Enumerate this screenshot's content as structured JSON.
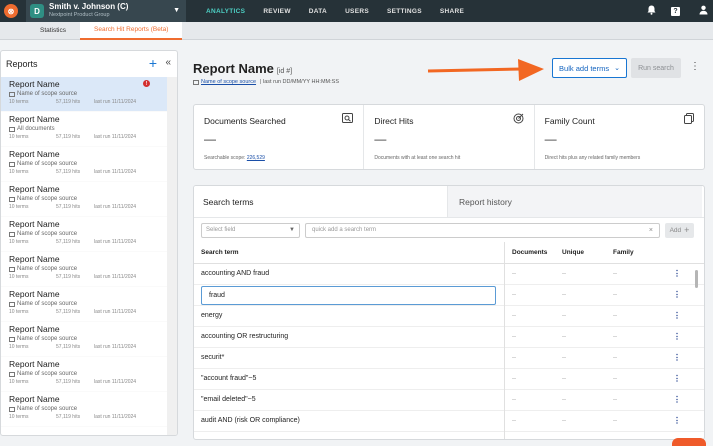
{
  "topbar": {
    "logo_letter": "⊗",
    "case_avatar": "D",
    "case_name": "Smith v. Johnson (C)",
    "case_sub": "Nextpoint Product Group",
    "nav": [
      "ANALYTICS",
      "REVIEW",
      "DATA",
      "USERS",
      "SETTINGS",
      "SHARE"
    ],
    "active_nav": "ANALYTICS",
    "help_label": "?"
  },
  "subtabs": [
    "Statistics",
    "Search Hit Reports (Beta)"
  ],
  "sidebar": {
    "title": "Reports",
    "reports": [
      {
        "name": "Report Name",
        "scope": "Name of scope source",
        "terms": "10 terms",
        "hits": "57,119 hits",
        "run": "last run 11/11/2024",
        "selected": true,
        "alert": "!"
      },
      {
        "name": "Report Name",
        "scope": "All documents",
        "terms": "10 terms",
        "hits": "57,119 hits",
        "run": "last run 11/11/2024"
      },
      {
        "name": "Report Name",
        "scope": "Name of scope source",
        "terms": "10 terms",
        "hits": "57,119 hits",
        "run": "last run 11/11/2024"
      },
      {
        "name": "Report Name",
        "scope": "Name of scope source",
        "terms": "10 terms",
        "hits": "57,119 hits",
        "run": "last run 11/11/2024"
      },
      {
        "name": "Report Name",
        "scope": "Name of scope source",
        "terms": "10 terms",
        "hits": "57,119 hits",
        "run": "last run 11/11/2024"
      },
      {
        "name": "Report Name",
        "scope": "Name of scope source",
        "terms": "10 terms",
        "hits": "57,119 hits",
        "run": "last run 11/11/2024"
      },
      {
        "name": "Report Name",
        "scope": "Name of scope source",
        "terms": "10 terms",
        "hits": "57,119 hits",
        "run": "last run 11/11/2024"
      },
      {
        "name": "Report Name",
        "scope": "Name of scope source",
        "terms": "10 terms",
        "hits": "57,119 hits",
        "run": "last run 11/11/2024"
      },
      {
        "name": "Report Name",
        "scope": "Name of scope source",
        "terms": "10 terms",
        "hits": "57,119 hits",
        "run": "last run 11/11/2024"
      },
      {
        "name": "Report Name",
        "scope": "Name of scope source",
        "terms": "10 terms",
        "hits": "57,119 hits",
        "run": "last run 11/11/2024"
      }
    ]
  },
  "main": {
    "title": "Report Name",
    "id": "[id #]",
    "scope_link": "Name of scope source",
    "last_run": "| last run DD/MM/YY HH:MM:SS",
    "bulk_button": "Bulk add terms",
    "run_button": "Run search",
    "stats": [
      {
        "title": "Documents Searched",
        "value": "—",
        "foot_label": "Searchable scope:",
        "foot_link": "226,529",
        "icon": "search-doc-icon"
      },
      {
        "title": "Direct Hits",
        "value": "—",
        "foot_label": "Documents with at least one search hit",
        "foot_link": "",
        "icon": "target-icon"
      },
      {
        "title": "Family Count",
        "value": "—",
        "foot_label": "Direct hits plus any related family members",
        "foot_link": "",
        "icon": "copy-icon"
      }
    ],
    "tabs": [
      "Search terms",
      "Report history"
    ],
    "select_placeholder": "Select field",
    "quick_placeholder": "quick add a search term",
    "add_label": "Add",
    "columns": [
      "Search term",
      "Documents",
      "Unique",
      "Family"
    ],
    "rows": [
      {
        "term": "accounting AND fraud",
        "docs": "--",
        "unique": "--",
        "family": "--"
      },
      {
        "term": "fraud",
        "docs": "--",
        "unique": "--",
        "family": "--",
        "editing": true
      },
      {
        "term": "energy",
        "docs": "--",
        "unique": "--",
        "family": "--"
      },
      {
        "term": "accounting OR restructuring",
        "docs": "--",
        "unique": "--",
        "family": "--"
      },
      {
        "term": "securit*",
        "docs": "--",
        "unique": "--",
        "family": "--"
      },
      {
        "term": "\"account fraud\"~5",
        "docs": "--",
        "unique": "--",
        "family": "--"
      },
      {
        "term": "\"email deleted\"~5",
        "docs": "--",
        "unique": "--",
        "family": "--"
      },
      {
        "term": "audit AND (risk OR compliance)",
        "docs": "--",
        "unique": "--",
        "family": "--"
      }
    ]
  },
  "colors": {
    "accent": "#ef6c2f",
    "primary": "#1976d2",
    "topbar": "#263238",
    "nav_active": "#4dd0c4"
  }
}
